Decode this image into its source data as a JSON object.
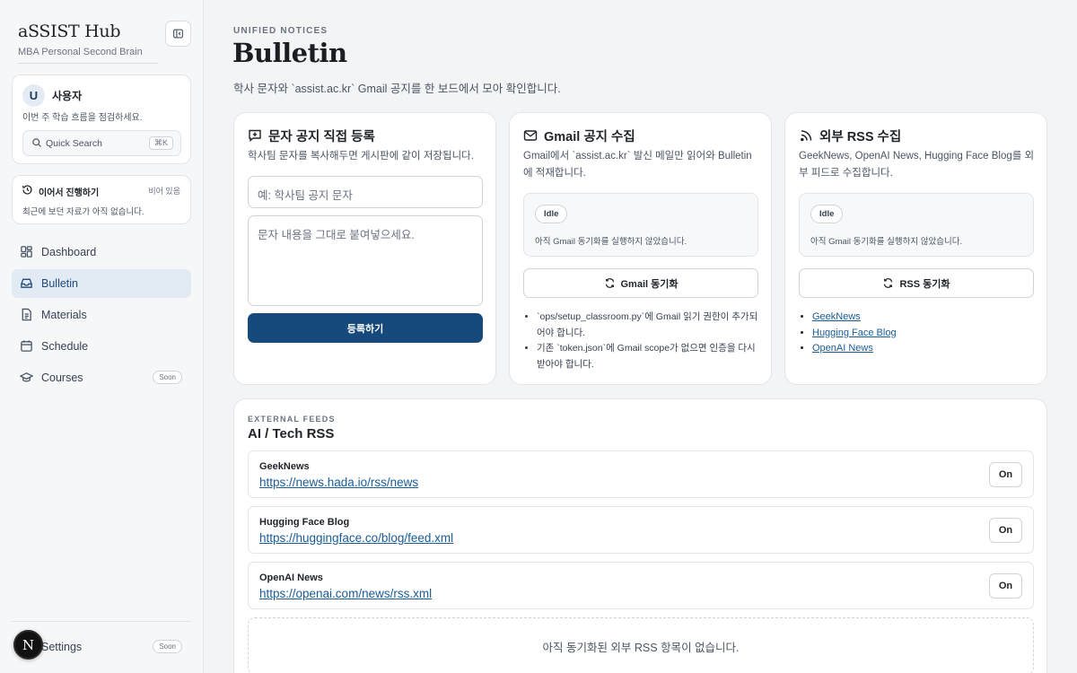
{
  "sidebar": {
    "brand_title": "aSSIST Hub",
    "brand_subtitle": "MBA Personal Second Brain",
    "user": {
      "avatar_initial": "U",
      "name": "사용자",
      "description": "이번 주 학습 흐름을 점검하세요."
    },
    "quick_search": {
      "label": "Quick Search",
      "shortcut": "⌘K"
    },
    "continue": {
      "title": "이어서 진행하기",
      "state": "비어 있음",
      "description": "최근에 보던 자료가 아직 없습니다."
    },
    "nav": [
      {
        "label": "Dashboard",
        "icon": "grid-icon"
      },
      {
        "label": "Bulletin",
        "icon": "inbox-icon",
        "active": true
      },
      {
        "label": "Materials",
        "icon": "document-icon"
      },
      {
        "label": "Schedule",
        "icon": "calendar-icon"
      },
      {
        "label": "Courses",
        "icon": "graduation-cap-icon",
        "badge": "Soon"
      }
    ],
    "settings": {
      "label": "Settings",
      "badge": "Soon"
    },
    "next_badge": "N"
  },
  "header": {
    "eyebrow": "UNIFIED NOTICES",
    "title": "Bulletin",
    "description": "학사 문자와 `assist.ac.kr` Gmail 공지를 한 보드에서 모아 확인합니다."
  },
  "cards": {
    "sms": {
      "title": "문자 공지 직접 등록",
      "description": "학사팀 문자를 복사해두면 게시판에 같이 저장됩니다.",
      "title_placeholder": "예: 학사팀 공지 문자",
      "body_placeholder": "문자 내용을 그대로 붙여넣으세요.",
      "submit_label": "등록하기"
    },
    "gmail": {
      "title": "Gmail 공지 수집",
      "description": "Gmail에서 `assist.ac.kr` 발신 메일만 읽어와 Bulletin에 적재합니다.",
      "status_badge": "Idle",
      "status_text": "아직 Gmail 동기화를 실행하지 않았습니다.",
      "sync_label": "Gmail 동기화",
      "notes": [
        "`ops/setup_classroom.py`에 Gmail 읽기 권한이 추가되어야 합니다.",
        "기존 `token.json`에 Gmail scope가 없으면 인증을 다시 받아야 합니다."
      ]
    },
    "rss": {
      "title": "외부 RSS 수집",
      "description": "GeekNews, OpenAI News, Hugging Face Blog를 외부 피드로 수집합니다.",
      "status_badge": "Idle",
      "status_text": "아직 Gmail 동기화를 실행하지 않았습니다.",
      "sync_label": "RSS 동기화",
      "links": [
        "GeekNews",
        "Hugging Face Blog",
        "OpenAI News"
      ]
    }
  },
  "feeds": {
    "eyebrow": "EXTERNAL FEEDS",
    "title": "AI / Tech RSS",
    "items": [
      {
        "name": "GeekNews",
        "url": "https://news.hada.io/rss/news",
        "toggle": "On"
      },
      {
        "name": "Hugging Face Blog",
        "url": "https://huggingface.co/blog/feed.xml",
        "toggle": "On"
      },
      {
        "name": "OpenAI News",
        "url": "https://openai.com/news/rss.xml",
        "toggle": "On"
      }
    ],
    "empty_text": "아직 동기화된 외부 RSS 항목이 없습니다."
  },
  "colors": {
    "accent": "#174a7c",
    "link": "#1a5c96",
    "active_nav_bg": "#e2eaf3"
  }
}
